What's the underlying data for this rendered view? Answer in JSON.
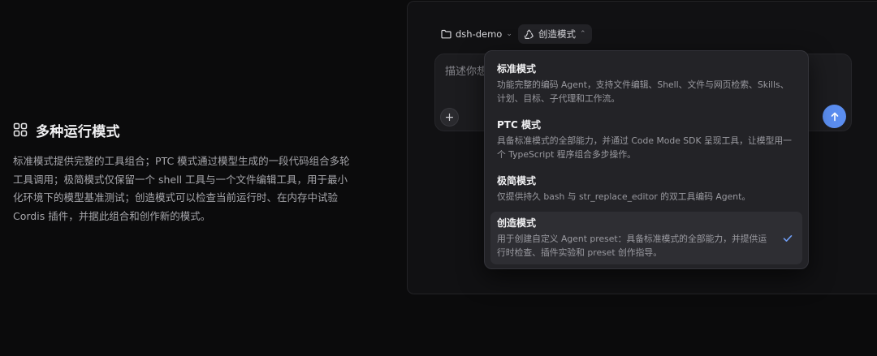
{
  "feature": {
    "title": "多种运行模式",
    "icon": "grid-icon",
    "description": "标准模式提供完整的工具组合；PTC 模式通过模型生成的一段代码组合多轮工具调用；极简模式仅保留一个 shell 工具与一个文件编辑工具，用于最小化环境下的模型基准测试；创造模式可以检查当前运行时、在内存中试验 Cordis 插件，并据此组合和创作新的模式。"
  },
  "toolbar": {
    "project_label": "dsh-demo",
    "mode_label": "创造模式"
  },
  "composer": {
    "placeholder": "描述你想"
  },
  "mode_menu": {
    "items": [
      {
        "title": "标准模式",
        "description": "功能完整的编码 Agent，支持文件编辑、Shell、文件与网页检索、Skills、计划、目标、子代理和工作流。"
      },
      {
        "title": "PTC 模式",
        "description": "具备标准模式的全部能力，并通过 Code Mode SDK 呈现工具，让模型用一个 TypeScript 程序组合多步操作。"
      },
      {
        "title": "极简模式",
        "description": "仅提供持久 bash 与 str_replace_editor 的双工具编码 Agent。"
      },
      {
        "title": "创造模式",
        "description": "用于创建自定义 Agent preset：具备标准模式的全部能力，并提供运行时检查、插件实验和 preset 创作指导。",
        "selected": true
      }
    ]
  },
  "colors": {
    "background": "#0b0b0c",
    "accent": "#5b8ef0",
    "check": "#6f9cf3"
  }
}
